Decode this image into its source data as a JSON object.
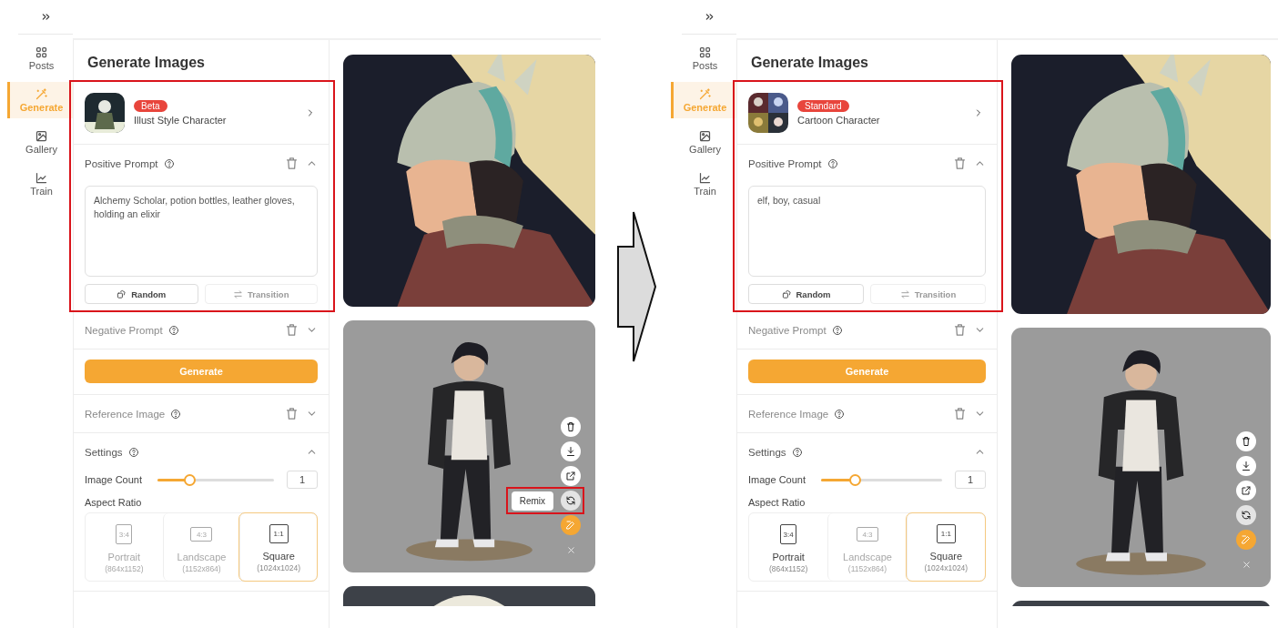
{
  "screens": [
    {
      "sidebar": [
        {
          "label": "Posts",
          "selected": false
        },
        {
          "label": "Generate",
          "selected": true
        },
        {
          "label": "Gallery",
          "selected": false
        },
        {
          "label": "Train",
          "selected": false
        }
      ],
      "title": "Generate Images",
      "focus_box": true,
      "model": {
        "badge": "Beta",
        "name": "Illust Style Character"
      },
      "positive_prompt": {
        "label": "Positive Prompt",
        "expanded": true,
        "clearable": true,
        "value": "Alchemy Scholar, potion bottles, leather gloves, holding an elixir",
        "buttons": [
          {
            "label": "Random",
            "disabled": false
          },
          {
            "label": "Transition",
            "disabled": true
          }
        ]
      },
      "negative_prompt": {
        "label": "Negative Prompt",
        "expanded": false,
        "clearable": true
      },
      "generate_button": "Generate",
      "reference_image": {
        "label": "Reference Image",
        "expanded": false,
        "clearable": true
      },
      "settings": {
        "label": "Settings",
        "expanded": true,
        "clearable": false,
        "image_count": {
          "label": "Image Count",
          "level": 0.27,
          "value": "1"
        },
        "aspect_ratio": {
          "label": "Aspect Ratio",
          "options": [
            {
              "ratio": "3:4",
              "label": "Portrait",
              "size": "(864x1152)",
              "disabled": true,
              "selected": false
            },
            {
              "ratio": "4:3",
              "label": "Landscape",
              "size": "(1152x864)",
              "disabled": true,
              "selected": false
            },
            {
              "ratio": "1:1",
              "label": "Square",
              "size": "(1024x1024)",
              "disabled": false,
              "selected": true
            }
          ]
        }
      },
      "images": [
        {
          "kind": "picture"
        },
        {
          "kind": "picture",
          "toolbar": {
            "tooltip": "Remix",
            "focus_box": true
          }
        },
        {
          "kind": "picture"
        }
      ]
    },
    {
      "sidebar": [
        {
          "label": "Posts",
          "selected": false
        },
        {
          "label": "Generate",
          "selected": true
        },
        {
          "label": "Gallery",
          "selected": false
        },
        {
          "label": "Train",
          "selected": false
        }
      ],
      "title": "Generate Images",
      "focus_box": true,
      "model": {
        "badge": "Standard",
        "name": "Cartoon Character"
      },
      "positive_prompt": {
        "label": "Positive Prompt",
        "expanded": true,
        "clearable": true,
        "value": "elf, boy, casual",
        "buttons": [
          {
            "label": "Random",
            "disabled": false
          },
          {
            "label": "Transition",
            "disabled": true
          }
        ]
      },
      "negative_prompt": {
        "label": "Negative Prompt",
        "expanded": false,
        "clearable": true
      },
      "generate_button": "Generate",
      "reference_image": {
        "label": "Reference Image",
        "expanded": false,
        "clearable": true
      },
      "settings": {
        "label": "Settings",
        "expanded": true,
        "clearable": false,
        "image_count": {
          "label": "Image Count",
          "level": 0.28,
          "value": "1"
        },
        "aspect_ratio": {
          "label": "Aspect Ratio",
          "options": [
            {
              "ratio": "3:4",
              "label": "Portrait",
              "size": "(864x1152)",
              "disabled": false,
              "selected": false
            },
            {
              "ratio": "4:3",
              "label": "Landscape",
              "size": "(1152x864)",
              "disabled": true,
              "selected": false
            },
            {
              "ratio": "1:1",
              "label": "Square",
              "size": "(1024x1024)",
              "disabled": false,
              "selected": true
            }
          ]
        }
      },
      "images": [
        {
          "kind": "picture"
        },
        {
          "kind": "picture",
          "toolbar": {
            "focus_box": false
          }
        },
        {
          "kind": "picture"
        }
      ]
    }
  ]
}
